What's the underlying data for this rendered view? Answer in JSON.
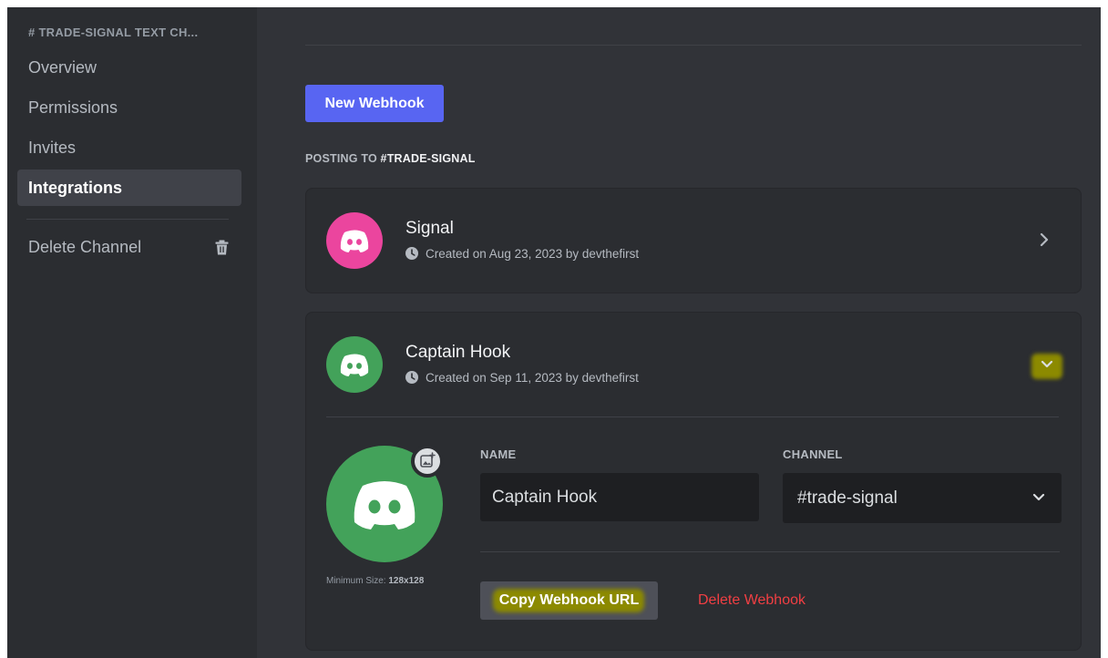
{
  "sidebar": {
    "header": "# TRADE-SIGNAL TEXT CH...",
    "items": [
      {
        "label": "Overview",
        "active": false
      },
      {
        "label": "Permissions",
        "active": false
      },
      {
        "label": "Invites",
        "active": false
      },
      {
        "label": "Integrations",
        "active": true
      }
    ],
    "delete_label": "Delete Channel",
    "delete_icon": "trash-icon"
  },
  "main": {
    "new_webhook_label": "New Webhook",
    "posting_prefix": "POSTING TO ",
    "posting_channel": "#TRADE-SIGNAL",
    "webhooks": [
      {
        "name": "Signal",
        "created": "Created on Aug 23, 2023 by devthefirst",
        "avatar_color": "#eb459e",
        "expanded": false
      },
      {
        "name": "Captain Hook",
        "created": "Created on Sep 11, 2023 by devthefirst",
        "avatar_color": "#43a25a",
        "expanded": true,
        "form": {
          "min_size": "Minimum Size: ",
          "min_size_value": "128x128",
          "name_label": "NAME",
          "name_value": "Captain Hook",
          "channel_label": "CHANNEL",
          "channel_value": "#trade-signal",
          "copy_label": "Copy Webhook URL",
          "delete_label": "Delete Webhook"
        }
      }
    ]
  },
  "colors": {
    "brand": "#5865f2",
    "danger": "#f23f43",
    "highlight": "#8c8a00"
  }
}
